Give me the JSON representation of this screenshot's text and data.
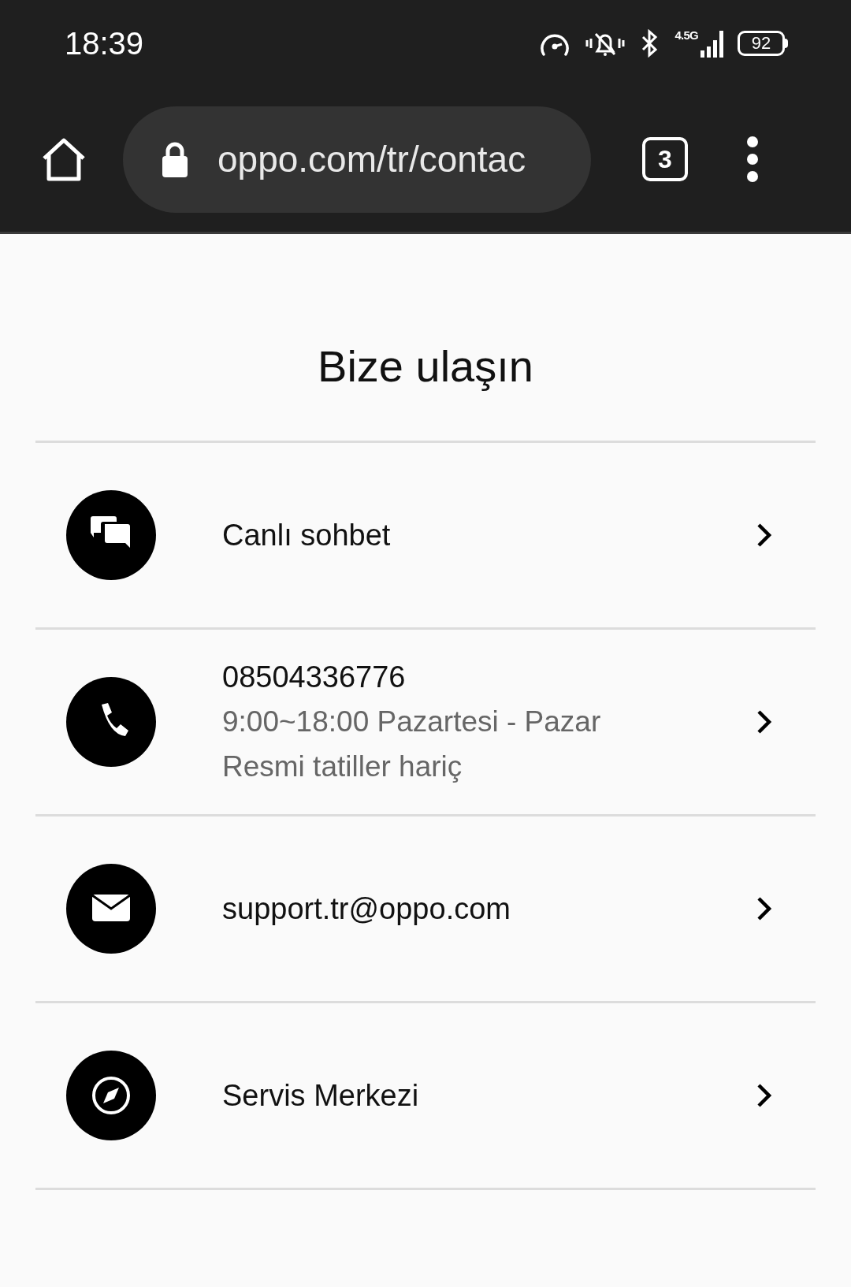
{
  "status_bar": {
    "time": "18:39",
    "network": "4.5G",
    "battery": "92"
  },
  "browser": {
    "url": "oppo.com/tr/contac",
    "tab_count": "3"
  },
  "page": {
    "title": "Bize ulaşın",
    "items": [
      {
        "title": "Canlı sohbet"
      },
      {
        "title": "08504336776",
        "details": [
          "9:00~18:00 Pazartesi - Pazar",
          "Resmi tatiller hariç"
        ]
      },
      {
        "title": "support.tr@oppo.com"
      },
      {
        "title": "Servis Merkezi"
      }
    ]
  }
}
